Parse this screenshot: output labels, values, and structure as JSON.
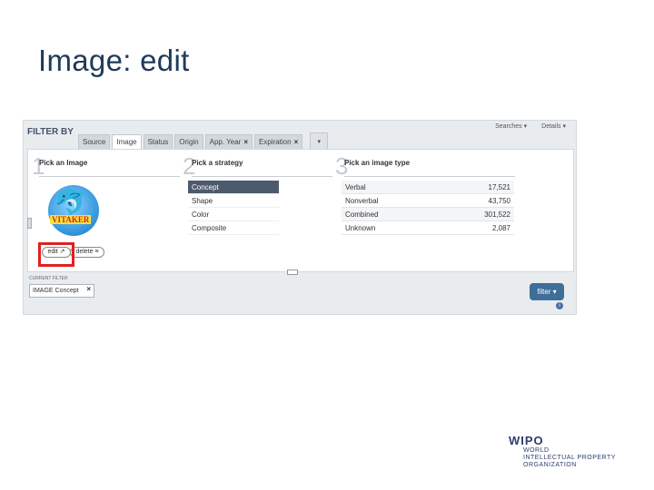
{
  "slide": {
    "title": "Image: edit"
  },
  "header": {
    "filter_by": "FILTER BY",
    "top_right": [
      "Searches ▾",
      "Details ▾"
    ]
  },
  "tabs": [
    {
      "label": "Source",
      "closable": false,
      "active": false
    },
    {
      "label": "Image",
      "closable": false,
      "active": true
    },
    {
      "label": "Status",
      "closable": false,
      "active": false
    },
    {
      "label": "Origin",
      "closable": false,
      "active": false
    },
    {
      "label": "App. Year",
      "closable": true,
      "active": false
    },
    {
      "label": "Expiration",
      "closable": true,
      "active": false
    }
  ],
  "tab_more_icon": "chevron-down-icon",
  "steps": [
    {
      "num": "1",
      "heading": "Pick an Image"
    },
    {
      "num": "2",
      "heading": "Pick a strategy"
    },
    {
      "num": "3",
      "heading": "Pick an image type"
    }
  ],
  "image_step": {
    "logo_text": "VITAKER",
    "edit_label": "edit ↗",
    "delete_label": "delete ≡"
  },
  "strategies": [
    {
      "label": "Concept",
      "selected": true
    },
    {
      "label": "Shape",
      "selected": false
    },
    {
      "label": "Color",
      "selected": false
    },
    {
      "label": "Composite",
      "selected": false
    }
  ],
  "image_types": [
    {
      "label": "Verbal",
      "count": "17,521"
    },
    {
      "label": "Nonverbal",
      "count": "43,750"
    },
    {
      "label": "Combined",
      "count": "301,522"
    },
    {
      "label": "Unknown",
      "count": "2,087"
    }
  ],
  "filter_button": "filter ▾",
  "current_filter": {
    "label": "CURRENT FILTER",
    "chip": "IMAGE Concept",
    "chip_close": "×"
  },
  "footer": {
    "org_logo": "WIPO",
    "org_lines": [
      "WORLD",
      "INTELLECTUAL PROPERTY",
      "ORGANIZATION"
    ]
  },
  "colors": {
    "highlight": "#e02020",
    "selected_row": "#4d5a6e",
    "filter_button": "#3f6e98"
  }
}
